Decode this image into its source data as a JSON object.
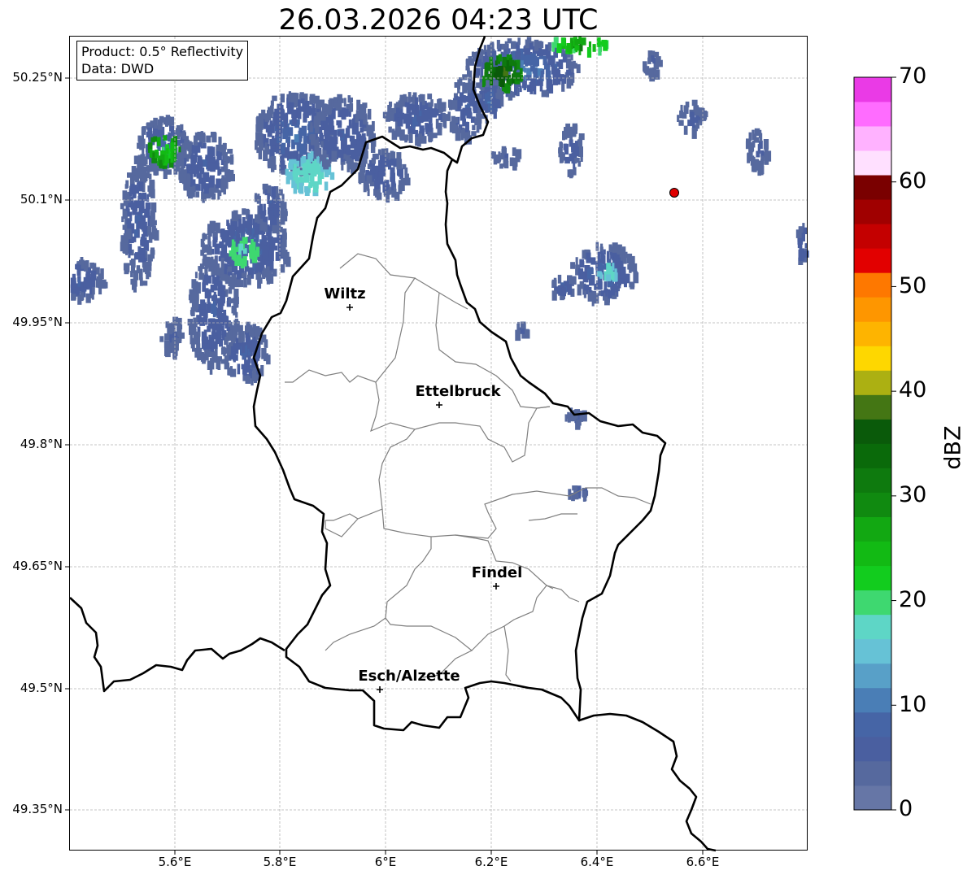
{
  "title": "26.03.2026 04:23 UTC",
  "info": {
    "product": "Product: 0.5° Reflectivity",
    "data": "Data: DWD"
  },
  "axes": {
    "lat_labels": [
      "50.25°N",
      "50.1°N",
      "49.95°N",
      "49.8°N",
      "49.65°N",
      "49.5°N",
      "49.35°N"
    ],
    "lon_labels": [
      "5.6°E",
      "5.8°E",
      "6°E",
      "6.2°E",
      "6.4°E",
      "6.6°E"
    ]
  },
  "cities": [
    {
      "name": "Wiltz"
    },
    {
      "name": "Ettelbruck"
    },
    {
      "name": "Findel"
    },
    {
      "name": "Esch/Alzette"
    }
  ],
  "colorbar": {
    "unit": "dBZ",
    "ticks": [
      "0",
      "10",
      "20",
      "30",
      "40",
      "50",
      "60",
      "70"
    ],
    "colors": [
      "#6676a6",
      "#56699e",
      "#4a5fa0",
      "#4665a6",
      "#4a7eb6",
      "#58a0c8",
      "#66c2d6",
      "#5ed6c6",
      "#3ed870",
      "#12cc1e",
      "#12ba14",
      "#12a812",
      "#108a10",
      "#0e7a0e",
      "#0a6a0a",
      "#0a5a0a",
      "#447614",
      "#acb012",
      "#fed700",
      "#feb400",
      "#fe9600",
      "#fe7800",
      "#e20000",
      "#c40000",
      "#a00000",
      "#7a0000",
      "#ffe0ff",
      "#ffb2ff",
      "#ff6cff",
      "#ea3ae6"
    ]
  },
  "marker_color": "#e00000"
}
